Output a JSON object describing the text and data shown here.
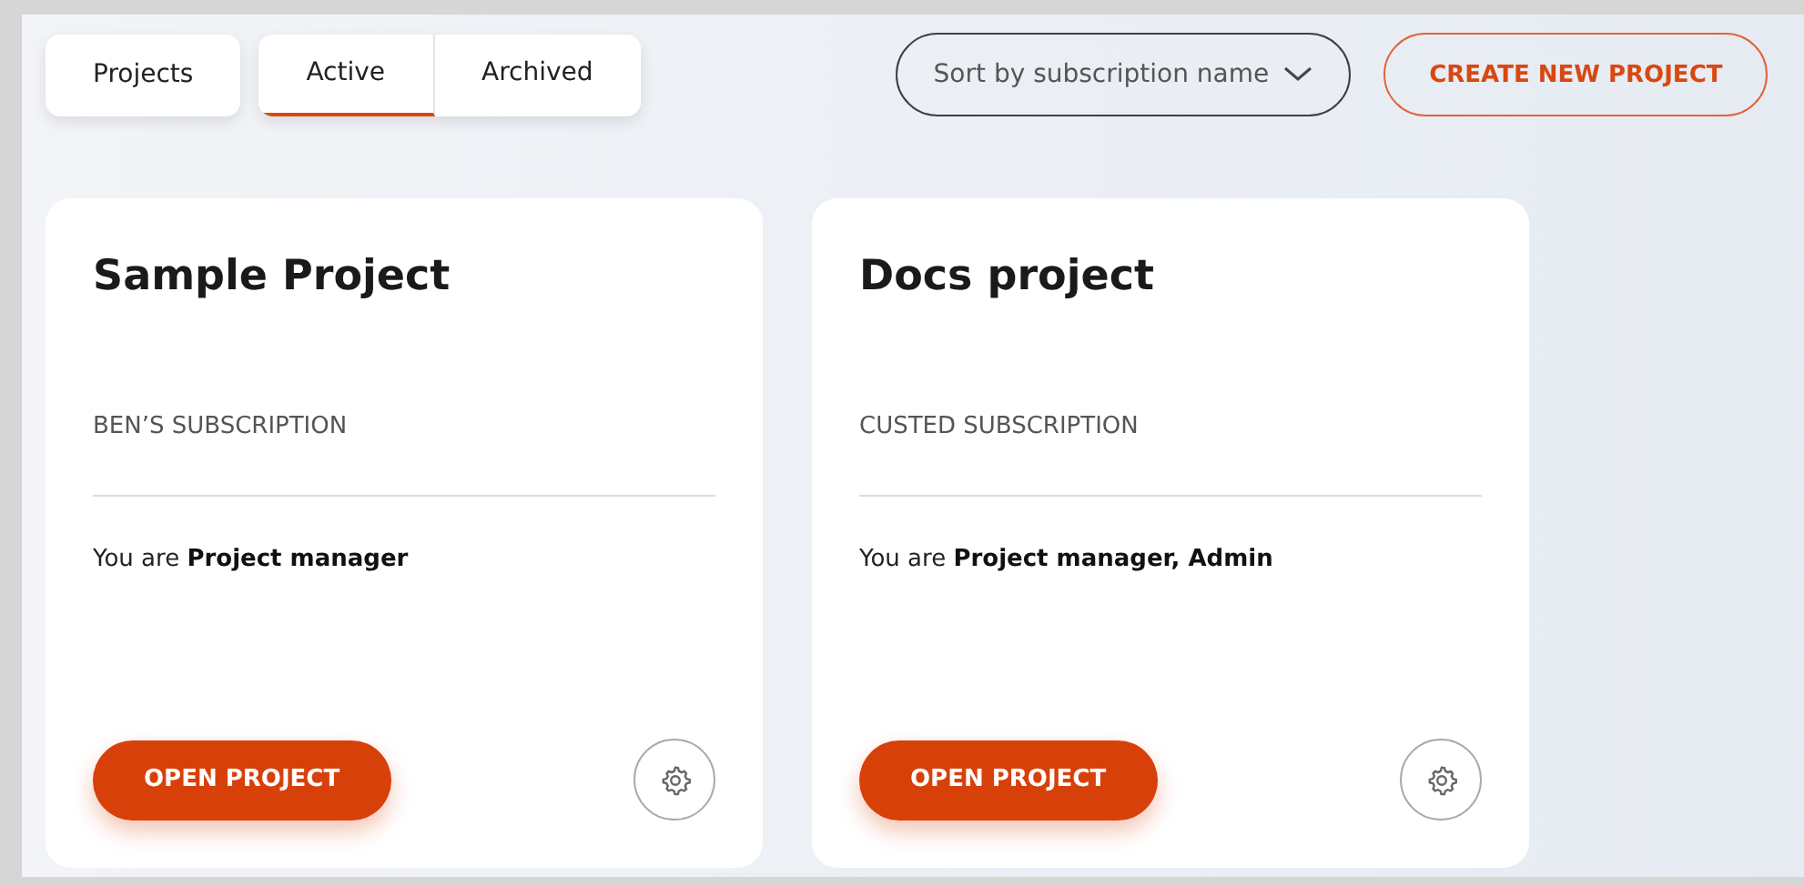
{
  "filter": {
    "label": "Projects"
  },
  "tabs": [
    {
      "label": "Active",
      "selected": true
    },
    {
      "label": "Archived",
      "selected": false
    }
  ],
  "sort": {
    "label": "Sort by subscription name"
  },
  "create_button": {
    "label": "CREATE NEW PROJECT"
  },
  "projects": [
    {
      "title": "Sample Project",
      "subscription": "BEN’S SUBSCRIPTION",
      "role": "You are **Project manager**",
      "button": "OPEN PROJECT"
    },
    {
      "title": "Docs project",
      "subscription": "CUSTED SUBSCRIPTION",
      "role": "You are **Project manager, Admin**",
      "button": "OPEN PROJECT"
    }
  ]
}
